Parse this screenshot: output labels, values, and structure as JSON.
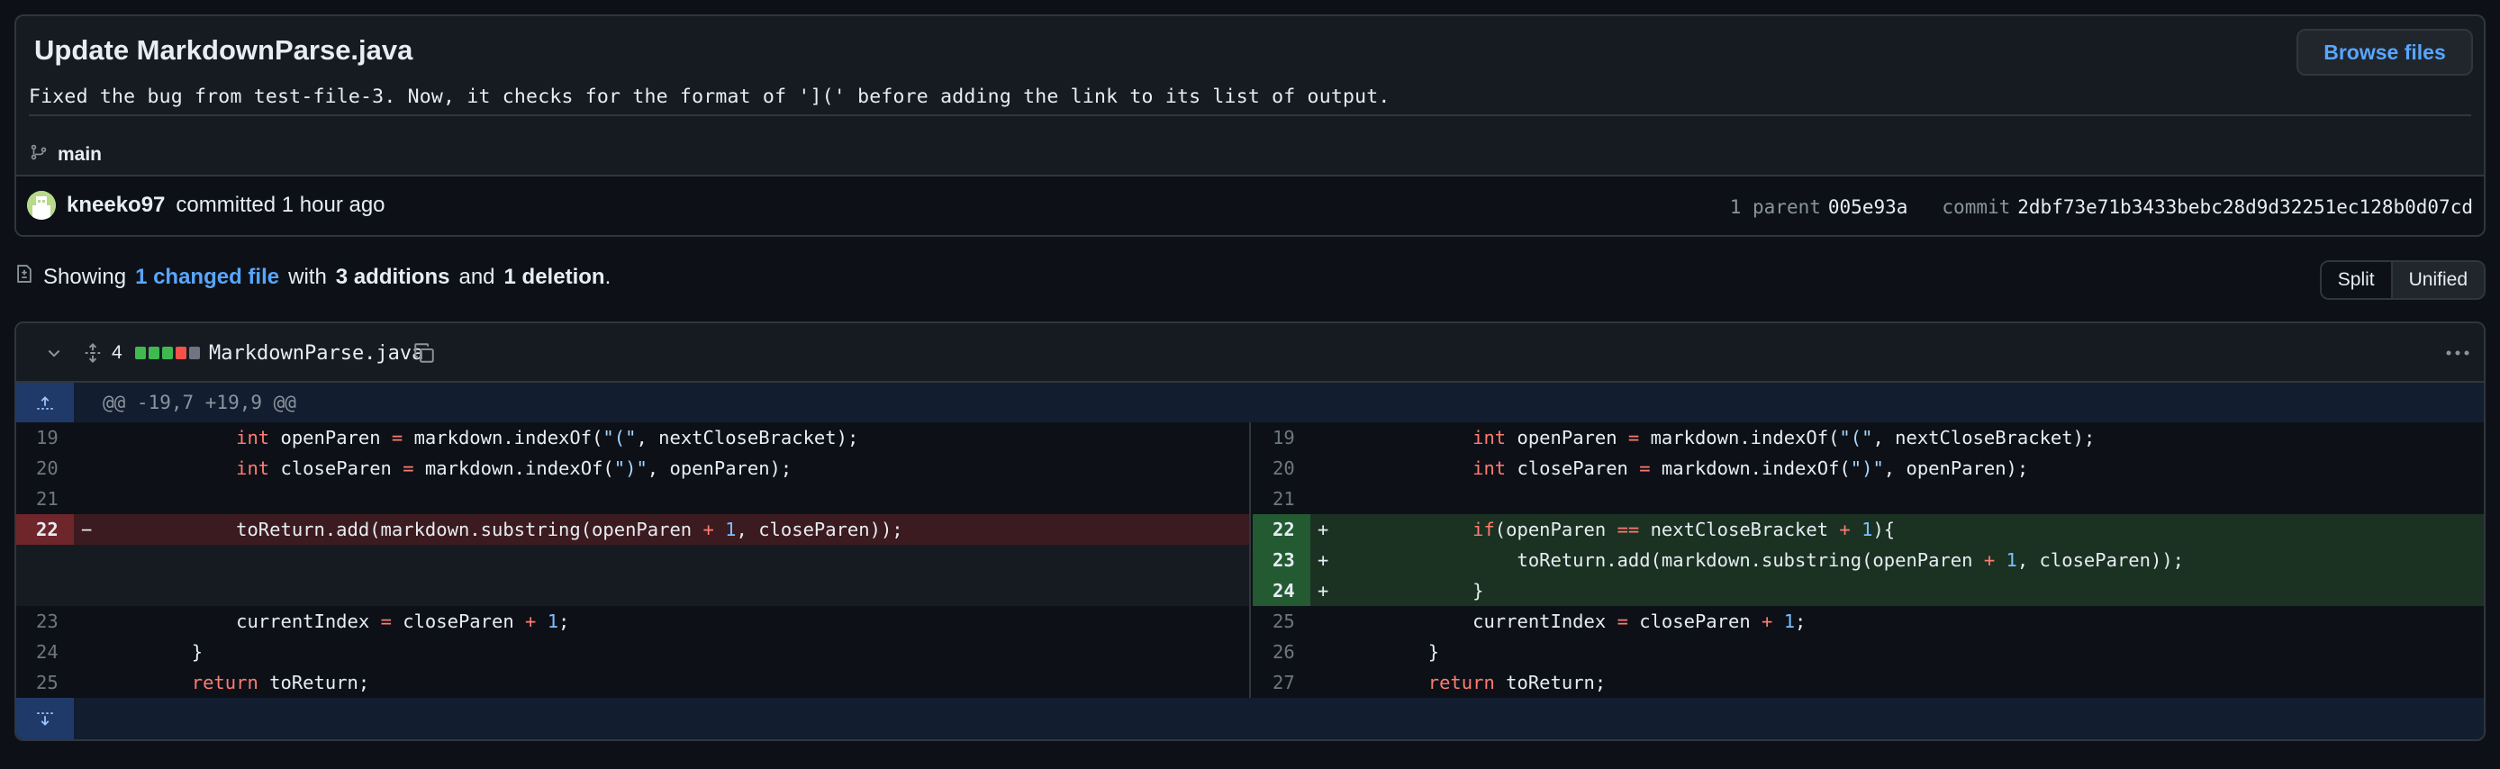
{
  "commit": {
    "title": "Update MarkdownParse.java",
    "description": "Fixed the bug from test-file-3. Now, it checks for the format of '](' before adding the link to its list of output.",
    "browse_label": "Browse files",
    "branch": "main",
    "author": "kneeko97",
    "committed_text": "committed 1 hour ago",
    "parent_label": "1 parent",
    "parent_sha": "005e93a",
    "commit_label": "commit",
    "commit_sha": "2dbf73e71b3433bebc28d9d32251ec128b0d07cd"
  },
  "summary": {
    "prefix": "Showing",
    "changed_files": "1 changed file",
    "with": "with",
    "additions": "3 additions",
    "and": "and",
    "deletions": "1 deletion",
    "period": "."
  },
  "view": {
    "split_label": "Split",
    "unified_label": "Unified",
    "active": "Unified"
  },
  "file": {
    "change_count": "4",
    "name": "MarkdownParse.java",
    "hunk_header": "@@ -19,7 +19,9 @@",
    "diffstat_colors": [
      "#3fb950",
      "#3fb950",
      "#3fb950",
      "#f85149",
      "#6e7681"
    ]
  },
  "left_lines": [
    {
      "num": "19",
      "type": "ctx",
      "sign": "",
      "code": "            int openParen = markdown.indexOf(\"(\", nextCloseBracket);"
    },
    {
      "num": "20",
      "type": "ctx",
      "sign": "",
      "code": "            int closeParen = markdown.indexOf(\")\", openParen);"
    },
    {
      "num": "21",
      "type": "ctx",
      "sign": "",
      "code": ""
    },
    {
      "num": "22",
      "type": "del",
      "sign": "−",
      "code": "            toReturn.add(markdown.substring(openParen + 1, closeParen));"
    },
    {
      "num": "",
      "type": "empty",
      "sign": "",
      "code": ""
    },
    {
      "num": "",
      "type": "empty",
      "sign": "",
      "code": ""
    },
    {
      "num": "23",
      "type": "ctx",
      "sign": "",
      "code": "            currentIndex = closeParen + 1;"
    },
    {
      "num": "24",
      "type": "ctx",
      "sign": "",
      "code": "        }"
    },
    {
      "num": "25",
      "type": "ctx",
      "sign": "",
      "code": "        return toReturn;"
    }
  ],
  "right_lines": [
    {
      "num": "19",
      "type": "ctx",
      "sign": "",
      "code": "            int openParen = markdown.indexOf(\"(\", nextCloseBracket);"
    },
    {
      "num": "20",
      "type": "ctx",
      "sign": "",
      "code": "            int closeParen = markdown.indexOf(\")\", openParen);"
    },
    {
      "num": "21",
      "type": "ctx",
      "sign": "",
      "code": ""
    },
    {
      "num": "22",
      "type": "add",
      "sign": "+",
      "code": "            if(openParen == nextCloseBracket + 1){"
    },
    {
      "num": "23",
      "type": "add",
      "sign": "+",
      "code": "                toReturn.add(markdown.substring(openParen + 1, closeParen));"
    },
    {
      "num": "24",
      "type": "add",
      "sign": "+",
      "code": "            }"
    },
    {
      "num": "25",
      "type": "ctx",
      "sign": "",
      "code": "            currentIndex = closeParen + 1;"
    },
    {
      "num": "26",
      "type": "ctx",
      "sign": "",
      "code": "        }"
    },
    {
      "num": "27",
      "type": "ctx",
      "sign": "",
      "code": "        return toReturn;"
    }
  ],
  "icons": {
    "branch": "git-branch-icon",
    "file_diff": "file-diff-icon",
    "collapse": "chevron-down-icon",
    "expand_all": "unfold-icon",
    "copy": "copy-icon",
    "kebab": "kebab-horizontal-icon",
    "expand_up": "expand-up-icon",
    "expand_down": "expand-down-icon"
  }
}
